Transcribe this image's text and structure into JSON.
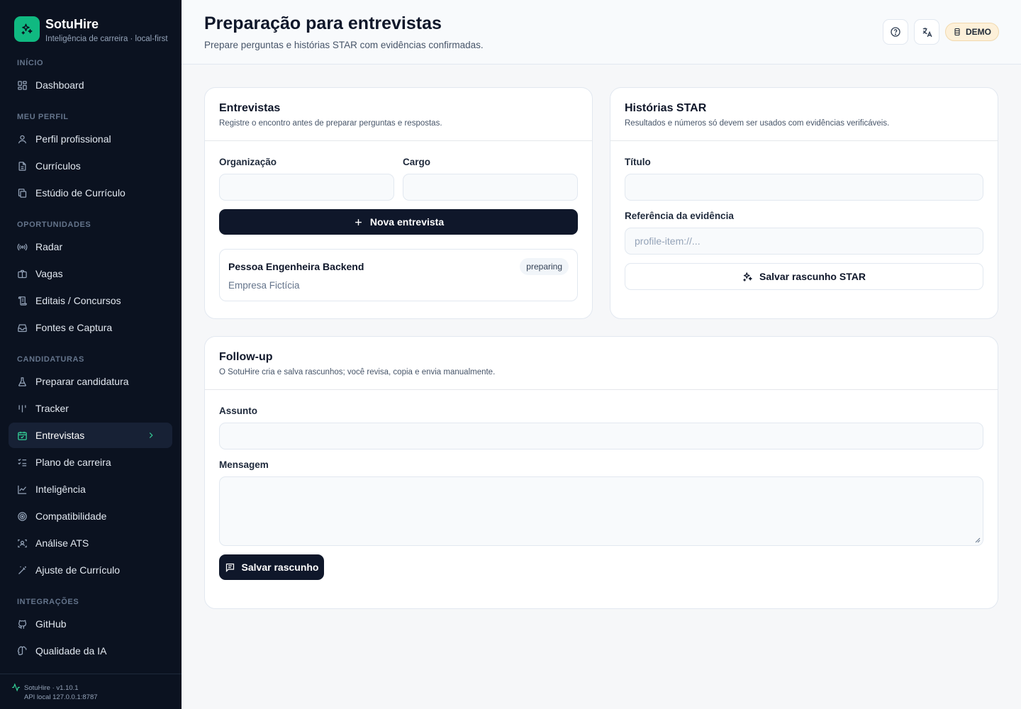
{
  "app": {
    "name": "SotuHire",
    "tagline": "Inteligência de carreira · local-first",
    "brand_color": "#10b981"
  },
  "sidebar": {
    "sections": [
      {
        "title": "INÍCIO",
        "items": [
          {
            "label": "Dashboard",
            "icon": "dashboard-icon"
          }
        ]
      },
      {
        "title": "MEU PERFIL",
        "items": [
          {
            "label": "Perfil profissional",
            "icon": "user-icon"
          },
          {
            "label": "Currículos",
            "icon": "file-icon"
          },
          {
            "label": "Estúdio de Currículo",
            "icon": "copy-file-icon"
          }
        ]
      },
      {
        "title": "OPORTUNIDADES",
        "items": [
          {
            "label": "Radar",
            "icon": "radar-icon"
          },
          {
            "label": "Vagas",
            "icon": "briefcase-icon"
          },
          {
            "label": "Editais / Concursos",
            "icon": "scroll-icon"
          },
          {
            "label": "Fontes e Captura",
            "icon": "inbox-icon"
          }
        ]
      },
      {
        "title": "CANDIDATURAS",
        "items": [
          {
            "label": "Preparar candidatura",
            "icon": "flask-icon"
          },
          {
            "label": "Tracker",
            "icon": "columns-icon"
          },
          {
            "label": "Entrevistas",
            "icon": "calendar-icon",
            "active": true
          },
          {
            "label": "Plano de carreira",
            "icon": "list-checks-icon"
          },
          {
            "label": "Inteligência",
            "icon": "line-chart-icon"
          },
          {
            "label": "Compatibilidade",
            "icon": "target-icon"
          },
          {
            "label": "Análise ATS",
            "icon": "scan-icon"
          },
          {
            "label": "Ajuste de Currículo",
            "icon": "wand-icon"
          }
        ]
      },
      {
        "title": "INTEGRAÇÕES",
        "items": [
          {
            "label": "GitHub",
            "icon": "github-icon"
          },
          {
            "label": "Qualidade da IA",
            "icon": "brain-icon"
          }
        ]
      }
    ],
    "footer": {
      "version": "SotuHire · v1.10.1",
      "api": "API local 127.0.0.1:8787"
    }
  },
  "header": {
    "title": "Preparação para entrevistas",
    "subtitle": "Prepare perguntas e histórias STAR com evidências confirmadas.",
    "demo_label": "DEMO"
  },
  "interviews": {
    "title": "Entrevistas",
    "description": "Registre o encontro antes de preparar perguntas e respostas.",
    "org_label": "Organização",
    "org_value": "",
    "role_label": "Cargo",
    "role_value": "",
    "new_button": "Nova entrevista",
    "items": [
      {
        "title": "Pessoa Engenheira Backend",
        "organization": "Empresa Fictícia",
        "status": "preparing"
      }
    ]
  },
  "star": {
    "title": "Histórias STAR",
    "description": "Resultados e números só devem ser usados com evidências verificáveis.",
    "title_label": "Título",
    "title_value": "",
    "evidence_label": "Referência da evidência",
    "evidence_placeholder": "profile-item://...",
    "save_button": "Salvar rascunho STAR"
  },
  "followup": {
    "title": "Follow-up",
    "description": "O SotuHire cria e salva rascunhos; você revisa, copia e envia manualmente.",
    "subject_label": "Assunto",
    "subject_value": "",
    "message_label": "Mensagem",
    "message_value": "",
    "save_button": "Salvar rascunho"
  }
}
